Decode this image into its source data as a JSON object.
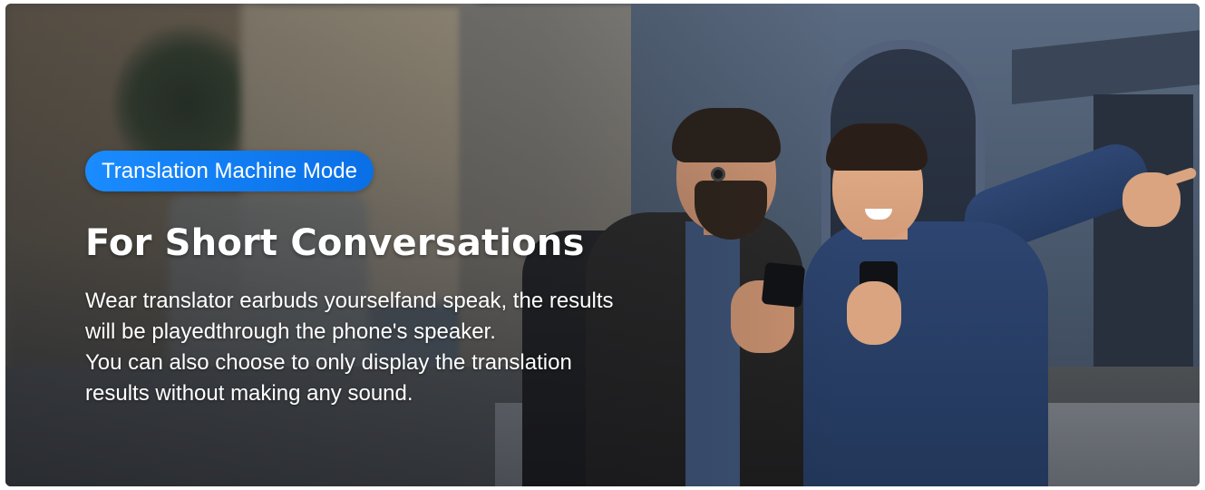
{
  "banner": {
    "badge_label": "Translation Machine Mode",
    "headline": "For Short Conversations",
    "description_lines": [
      "Wear translator earbuds yourselfand speak, the results",
      "will be playedthrough the phone's speaker.",
      "You can also choose to only display the translation",
      "results without making any sound."
    ],
    "colors": {
      "badge_gradient_start": "#1a8cff",
      "badge_gradient_end": "#0a6fe6",
      "text": "#ffffff"
    }
  }
}
